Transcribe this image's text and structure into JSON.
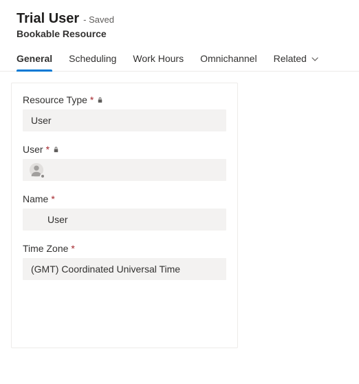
{
  "header": {
    "title": "Trial User",
    "saved_status": "- Saved",
    "subtitle": "Bookable Resource"
  },
  "tabs": {
    "items": [
      {
        "label": "General",
        "active": true
      },
      {
        "label": "Scheduling",
        "active": false
      },
      {
        "label": "Work Hours",
        "active": false
      },
      {
        "label": "Omnichannel",
        "active": false
      },
      {
        "label": "Related",
        "active": false,
        "has_chevron": true
      }
    ]
  },
  "form": {
    "resource_type": {
      "label": "Resource Type",
      "value": "User",
      "required": true,
      "locked": true
    },
    "user": {
      "label": "User",
      "value": "",
      "required": true,
      "locked": true
    },
    "name": {
      "label": "Name",
      "value": "User",
      "required": true
    },
    "time_zone": {
      "label": "Time Zone",
      "value": "(GMT) Coordinated Universal Time",
      "required": true
    }
  },
  "glyphs": {
    "required": "*"
  }
}
